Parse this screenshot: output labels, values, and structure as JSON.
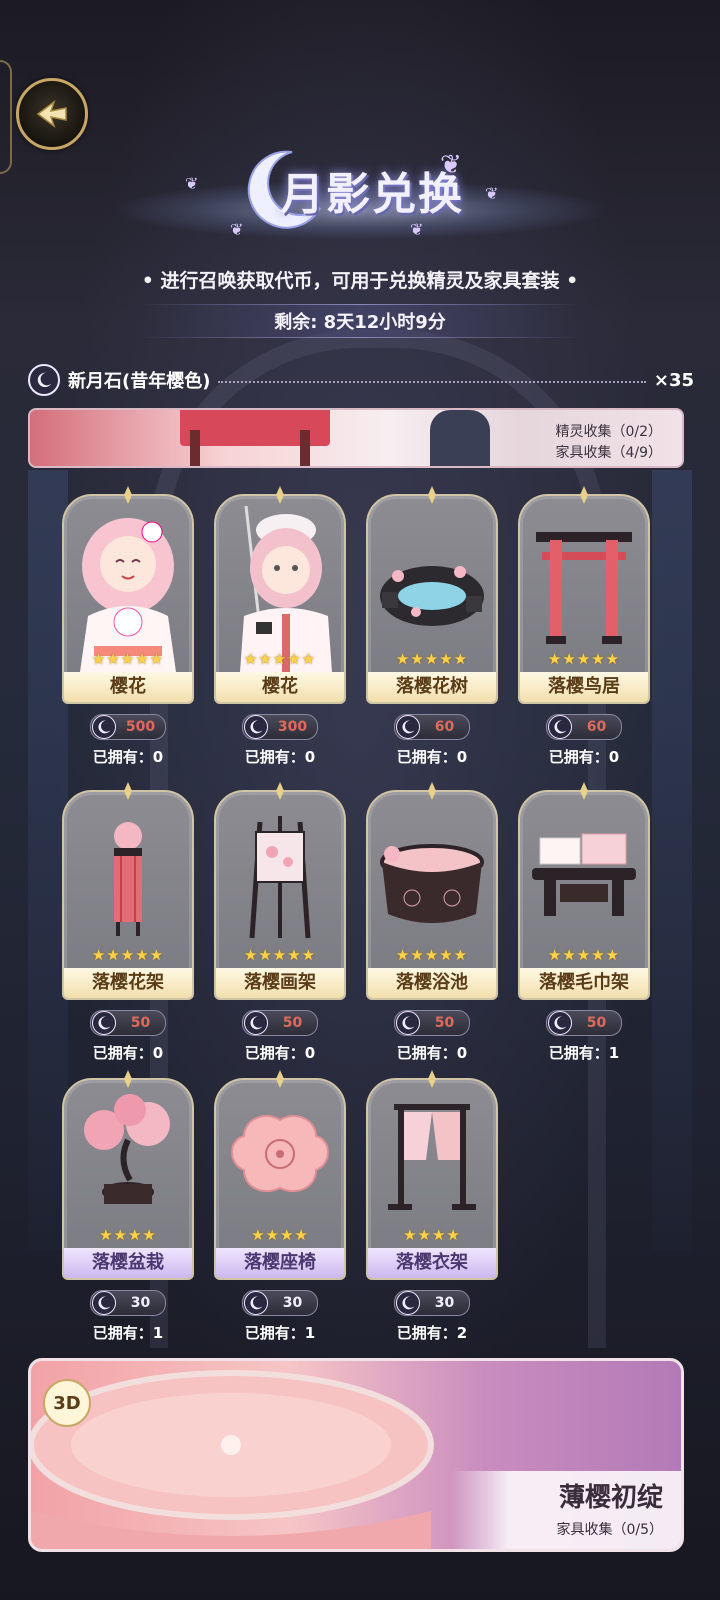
{
  "header": {
    "title": "月影兑换",
    "subtitle": "• 进行召唤获取代币，可用于兑换精灵及家具套装 •",
    "timer": "剩余: 8天12小时9分"
  },
  "currency": {
    "name": "新月石(昔年樱色)",
    "count": "×35",
    "icon": "crescent-moon-icon"
  },
  "banner_top": {
    "line1": "精灵收集（0/2）",
    "line2": "家具收集（4/9）"
  },
  "items": [
    {
      "name": "樱花",
      "stars": "★★★★★",
      "price": "500",
      "owned": "已拥有：0"
    },
    {
      "name": "樱花",
      "stars": "★★★★★",
      "price": "300",
      "owned": "已拥有：0"
    },
    {
      "name": "落樱花树",
      "stars": "★★★★★",
      "price": "60",
      "owned": "已拥有：0"
    },
    {
      "name": "落樱鸟居",
      "stars": "★★★★★",
      "price": "60",
      "owned": "已拥有：0"
    },
    {
      "name": "落樱花架",
      "stars": "★★★★★",
      "price": "50",
      "owned": "已拥有：0"
    },
    {
      "name": "落樱画架",
      "stars": "★★★★★",
      "price": "50",
      "owned": "已拥有：0"
    },
    {
      "name": "落樱浴池",
      "stars": "★★★★★",
      "price": "50",
      "owned": "已拥有：0"
    },
    {
      "name": "落樱毛巾架",
      "stars": "★★★★★",
      "price": "50",
      "owned": "已拥有：1"
    },
    {
      "name": "落樱盆栽",
      "stars": "★★★★",
      "price": "30",
      "owned": "已拥有：1"
    },
    {
      "name": "落樱座椅",
      "stars": "★★★★",
      "price": "30",
      "owned": "已拥有：1"
    },
    {
      "name": "落樱衣架",
      "stars": "★★★★",
      "price": "30",
      "owned": "已拥有：2"
    }
  ],
  "banner_bottom": {
    "badge": "3D",
    "title": "薄樱初绽",
    "subtitle": "家具收集（0/5）"
  },
  "colors": {
    "gold_border": "#c8a765",
    "price_unaffordable": "#e06a5a",
    "star": "#ffd24a"
  }
}
